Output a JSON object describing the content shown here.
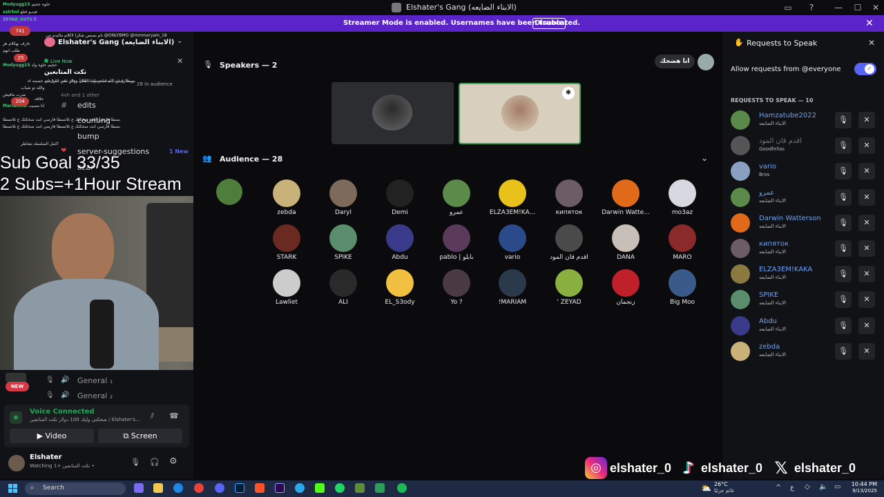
{
  "window": {
    "title": "Elshater's Gang (الابناء الضايعه)"
  },
  "banner": {
    "message": "Streamer Mode is enabled. Usernames have been truncated.",
    "disable_label": "Disable"
  },
  "chat_overlay": [
    {
      "user": "Modyugg15",
      "text": "حلوه جحيم"
    },
    {
      "user": "sstrbol",
      "text": "فيديو قتلع"
    },
    {
      "user": "ZEYAD_GUTS",
      "text": "5"
    },
    {
      "user": "",
      "text": "نام بصبص شكرا لاكلام ماليدم من @ONLYBMO @mmmaryam_18"
    },
    {
      "user": "",
      "text": "عارف بهكلام هز"
    },
    {
      "user": "",
      "text": "طلب انهم"
    },
    {
      "user": "Modyugg15",
      "text": "حجيم حلوه ولد"
    },
    {
      "user": "",
      "text": "نكت المتابعين"
    },
    {
      "user": "",
      "text": "بسطا يحس الله استحملت الفنان وجاي نحن تنازل انه جسمه اه"
    },
    {
      "user": "",
      "text": "والله تو شباب"
    },
    {
      "user": "",
      "text": "ضرب مافيش"
    },
    {
      "user": "",
      "text": "حلاقه"
    },
    {
      "user": "MariamXD",
      "text": "انا مسيب"
    },
    {
      "user": "",
      "text": "بسطا فارسي انت صحكتك ع تلاتسطا فارسي انت صحكتك ع تلاتسطا"
    },
    {
      "user": "",
      "text": "اكمل السلسله بشاطر"
    }
  ],
  "guild": {
    "name": "Elshater's Gang (الابناء الضايعه)",
    "live_label": "Live Now",
    "live_channel": "نكت المتابعين",
    "stage_desc": "بسطا يحس الله استحملت الفنان وجاي نحن تنازل انه | ضحكني وليك 100 دولار نكت المتابعين",
    "audience_count": "28 in audience",
    "others": "4vh and 1 other",
    "badges": [
      "741",
      "25",
      "204"
    ],
    "new_badge": "1 New",
    "new_pill": "NEW"
  },
  "channels": [
    {
      "name": "edits"
    },
    {
      "name": "counting"
    },
    {
      "name": "bump"
    },
    {
      "name": "server-suggestions"
    },
    {
      "name": "azar"
    }
  ],
  "voice_channels": [
    {
      "name": "General ₁"
    },
    {
      "name": "General ₂"
    }
  ],
  "overlay_text": {
    "goal": "Sub Goal 33/35",
    "rule": "2 Subs=+1Hour Stream"
  },
  "voice": {
    "status": "Voice Connected",
    "channel": "ضحكني وليك 100 دولار نكت المتابعين / Elshater's...",
    "video_label": "Video",
    "screen_label": "Screen"
  },
  "user": {
    "name": "Elshater",
    "status": "Watching نكت المتابعين +1 •"
  },
  "stage": {
    "speakers_label": "Speakers — 2",
    "audience_label": "Audience — 28",
    "host_button": "انا هضحك",
    "audience": [
      {
        "name": "zebda"
      },
      {
        "name": "Daryl"
      },
      {
        "name": "Demi"
      },
      {
        "name": "عمرو"
      },
      {
        "name": "ELZA3EM!KA..."
      },
      {
        "name": "кипяток"
      },
      {
        "name": "Darwin Watte..."
      },
      {
        "name": "mo3az"
      },
      {
        "name": "STARK"
      },
      {
        "name": "SPIKE"
      },
      {
        "name": "Abdu"
      },
      {
        "name": "pablo | بابلو"
      },
      {
        "name": "vario"
      },
      {
        "name": "اقدم قان المود"
      },
      {
        "name": "DANA"
      },
      {
        "name": "MARO"
      },
      {
        "name": "Lawliet"
      },
      {
        "name": "ALI"
      },
      {
        "name": "EL_S3ody"
      },
      {
        "name": "Yo ?"
      },
      {
        "name": "!MARIAM"
      },
      {
        "name": "' ZEYAD"
      },
      {
        "name": "زنجمان"
      },
      {
        "name": "Big Moo"
      }
    ]
  },
  "requests_panel": {
    "title": "Requests to Speak",
    "allow_label": "Allow requests from @everyone",
    "allow_enabled": true,
    "list_label": "REQUESTS TO SPEAK — 10",
    "requests": [
      {
        "name": "Hamzatube2022",
        "sub": "الابناء الضايعه"
      },
      {
        "name": "اقدم قان المود",
        "sub": "Goodfellas"
      },
      {
        "name": "vario",
        "sub": "Bros"
      },
      {
        "name": "عمرو",
        "sub": "الابناء الضايعه"
      },
      {
        "name": "Darwin Watterson",
        "sub": "الابناء الضايعه"
      },
      {
        "name": "кипяток",
        "sub": "الابناء الضايعه"
      },
      {
        "name": "ELZA3EM!KAKA",
        "sub": "الابناء الضايعه"
      },
      {
        "name": "SPIKE",
        "sub": "الابناء الضايعه"
      },
      {
        "name": "Abdu",
        "sub": "الابناء الضايعه"
      },
      {
        "name": "zebda",
        "sub": "الابناء الضايعه"
      }
    ]
  },
  "socials": {
    "instagram": "elshater_0",
    "tiktok": "elshater_0",
    "x": "elshater_0"
  },
  "taskbar": {
    "search_placeholder": "Search",
    "weather_temp": "26°C",
    "weather_desc": "غائم جزئيًا",
    "lang": "ع",
    "time": "10:44 PM",
    "date": "9/13/2025"
  },
  "colors": {
    "accent": "#5865f2",
    "banner": "#5a24c9",
    "speaking_border": "#3ba55c",
    "link_blue": "#6ea2f5"
  }
}
